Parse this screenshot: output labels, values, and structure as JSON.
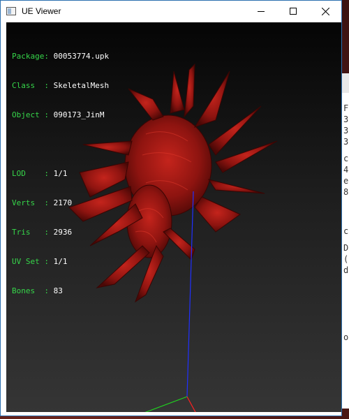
{
  "window": {
    "title": "UE Viewer",
    "controls": [
      "minimize",
      "maximize",
      "close"
    ]
  },
  "info": {
    "rows": [
      {
        "label": "Package:",
        "value": "00053774.upk"
      },
      {
        "label": "Class  :",
        "value": "SkeletalMesh"
      },
      {
        "label": "Object :",
        "value": "090173_JinM"
      }
    ],
    "stats": [
      {
        "label": "LOD    :",
        "value": "1/1"
      },
      {
        "label": "Verts  :",
        "value": "2170"
      },
      {
        "label": "Tris   :",
        "value": "2936"
      },
      {
        "label": "UV Set :",
        "value": "1/1"
      },
      {
        "label": "Bones  :",
        "value": "83"
      }
    ]
  },
  "behind_window_text": [
    "F",
    "3",
    "3",
    "3",
    "c",
    "4",
    "e",
    "8",
    "c",
    "D",
    "(",
    "d",
    "o"
  ],
  "colors": {
    "label": "#36d64a",
    "value": "#ffffff",
    "mesh": "#8e1410",
    "axis_x": "#ff2020",
    "axis_y": "#20d020",
    "axis_z": "#2030ff",
    "window_border": "#2b6fb0"
  },
  "icons": {
    "app": "app-window-icon",
    "minimize": "minimize-icon",
    "maximize": "maximize-icon",
    "close": "close-icon"
  }
}
